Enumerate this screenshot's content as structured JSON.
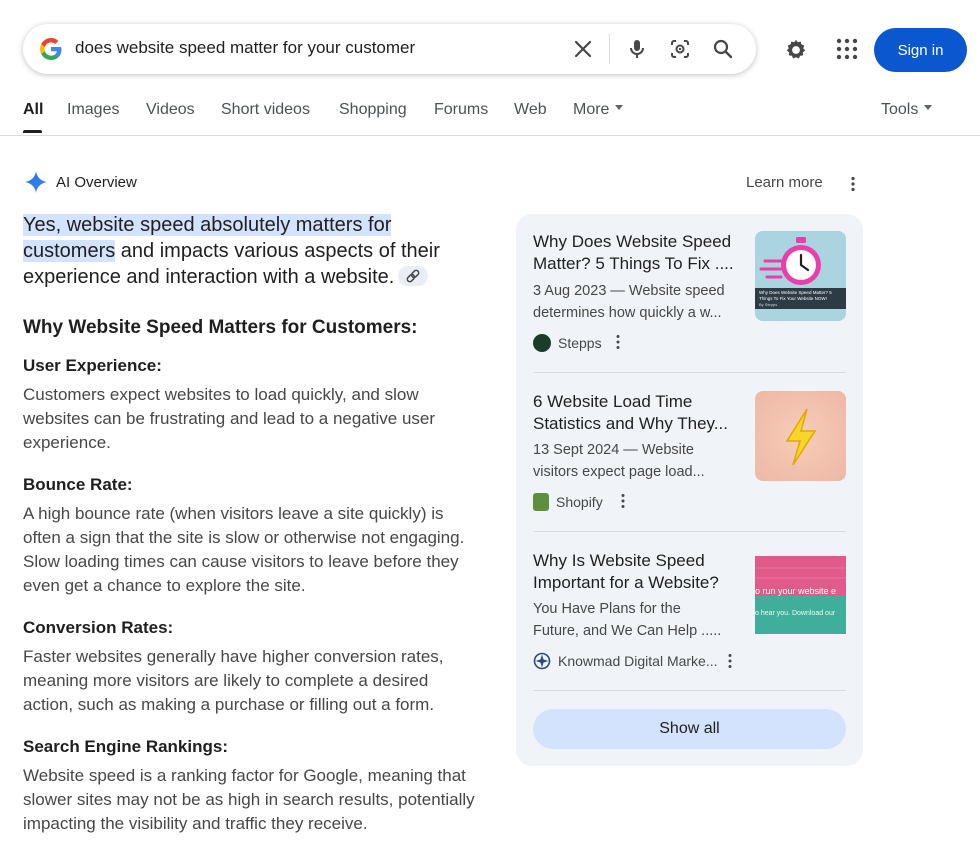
{
  "search": {
    "query": "does website speed matter for your customer"
  },
  "header": {
    "sign_in_label": "Sign in"
  },
  "tabs": [
    {
      "label": "All"
    },
    {
      "label": "Images"
    },
    {
      "label": "Videos"
    },
    {
      "label": "Short videos"
    },
    {
      "label": "Shopping"
    },
    {
      "label": "Forums"
    },
    {
      "label": "Web"
    },
    {
      "label": "More"
    }
  ],
  "tools_label": "Tools",
  "ai_overview": {
    "title": "AI Overview",
    "learn_more": "Learn more",
    "intro_highlight": "Yes, website speed absolutely matters for customers",
    "intro_rest": " and impacts various aspects of their experience and interaction with a website.",
    "section_title": "Why Website Speed Matters for Customers:",
    "points": [
      {
        "title": "User Experience:",
        "text": "Customers expect websites to load quickly, and slow websites can be frustrating and lead to a negative user experience."
      },
      {
        "title": "Bounce Rate:",
        "text": "A high bounce rate (when visitors leave a site quickly) is often a sign that the site is slow or otherwise not engaging. Slow loading times can cause visitors to leave before they even get a chance to explore the site."
      },
      {
        "title": "Conversion Rates:",
        "text": "Faster websites generally have higher conversion rates, meaning more visitors are likely to complete a desired action, such as making a purchase or filling out a form."
      },
      {
        "title": "Search Engine Rankings:",
        "text": "Website speed is a ranking factor for Google, meaning that slower sites may not be as high in search results, potentially impacting the visibility and traffic they receive."
      }
    ]
  },
  "sources": [
    {
      "title": "Why Does Website Speed Matter? 5 Things To Fix ....",
      "snippet_line1": "3 Aug 2023 — Website speed",
      "snippet_line2": "determines how quickly a w...",
      "site": "Stepps",
      "thumb_caption": "Why Does Website Speed Matter? 5 Things To Fix Your Website NOW!",
      "thumb_brand": "By Stepps"
    },
    {
      "title": "6 Website Load Time Statistics and Why They...",
      "snippet_line1": "13 Sept 2024 — Website",
      "snippet_line2": "visitors expect page load...",
      "site": "Shopify"
    },
    {
      "title": "Why Is Website Speed Important for a Website?",
      "snippet_line1": "You Have Plans for the",
      "snippet_line2": "Future, and We Can Help .....",
      "site": "Knowmad Digital Marke...",
      "thumb_text1": "o run your website e",
      "thumb_text2": "o hear you. Download our"
    }
  ],
  "show_all_label": "Show all",
  "colors": {
    "accent_blue": "#0b57d0",
    "highlight": "#d3e3fd",
    "panel_bg": "#f0f4f9"
  }
}
